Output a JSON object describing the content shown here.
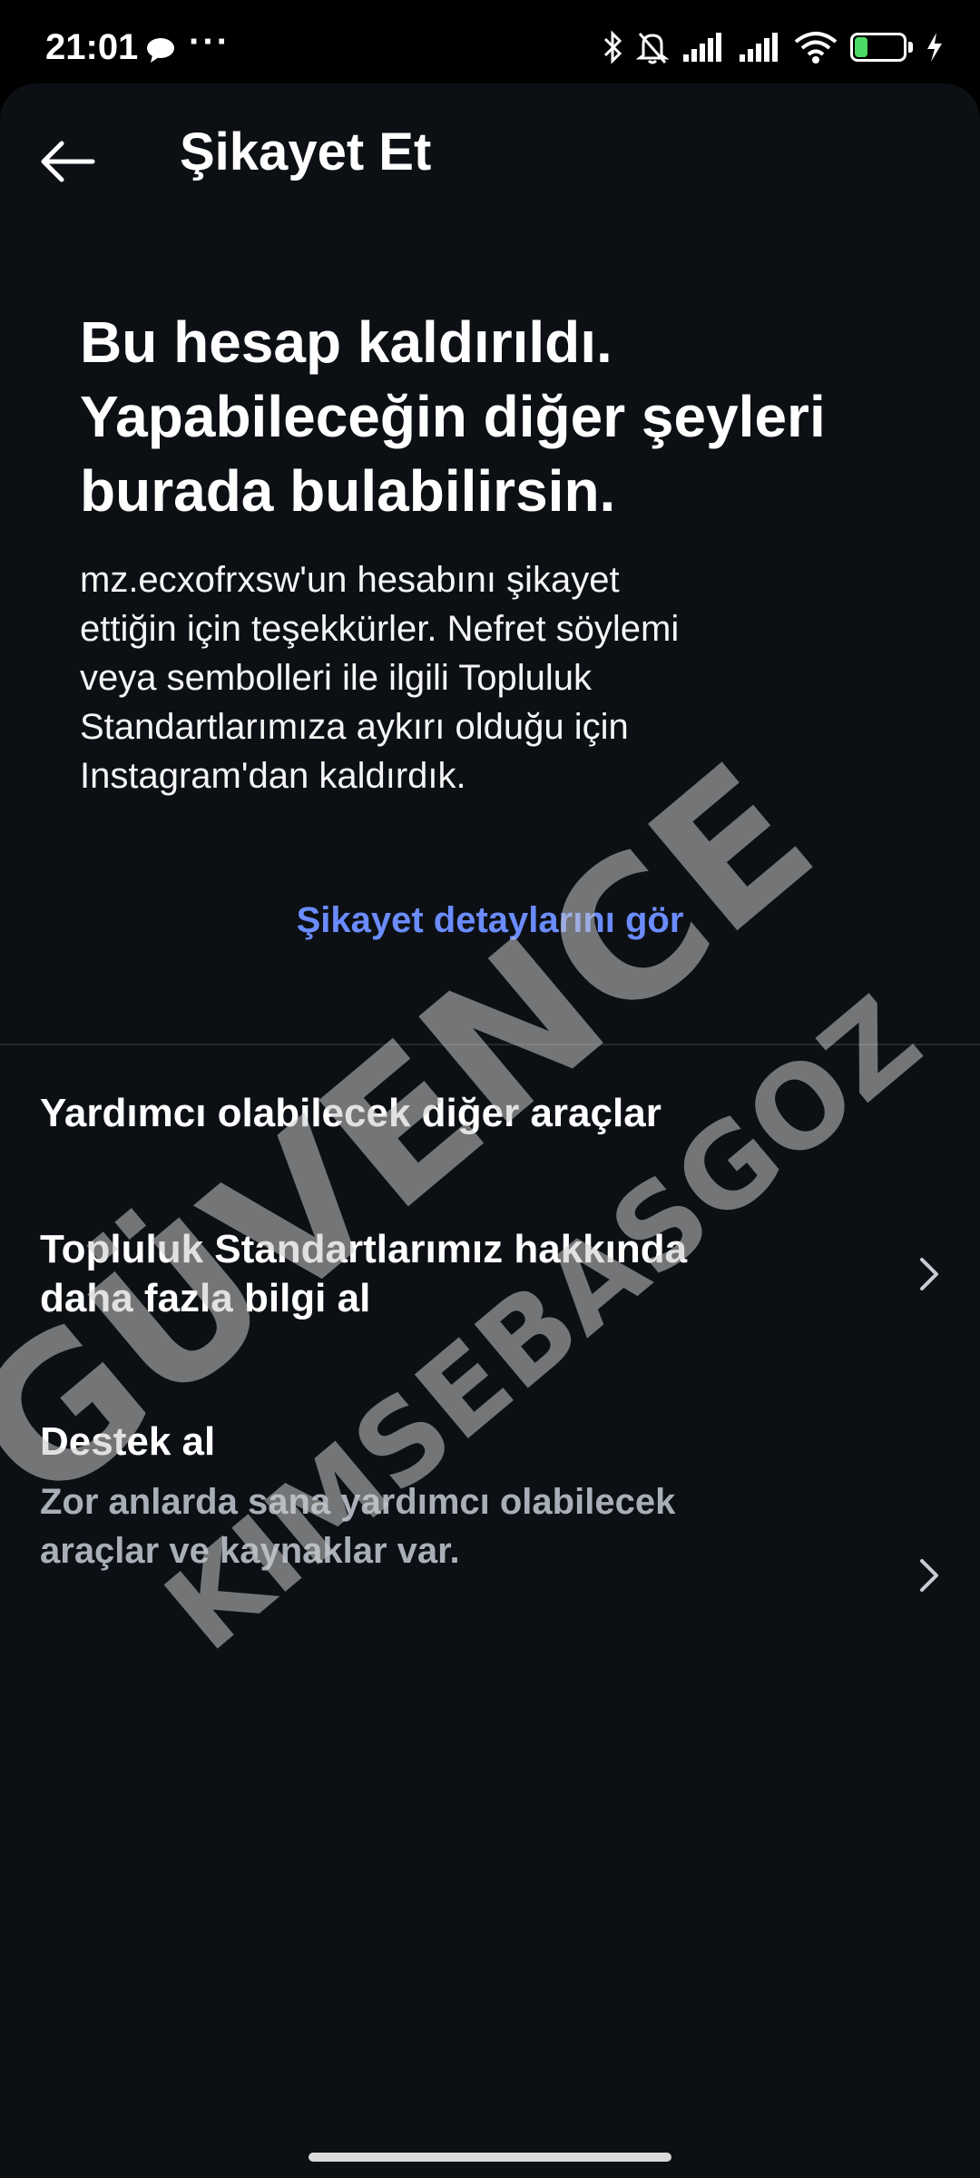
{
  "status_bar": {
    "time": "21:01",
    "dots": "···",
    "battery_level": "26",
    "battery_percent": 26,
    "icons": [
      "chat-bubble-icon",
      "bluetooth-icon",
      "mute-bell-icon",
      "signal-icon",
      "signal-icon",
      "wifi-icon",
      "battery-icon",
      "charging-bolt-icon"
    ]
  },
  "header": {
    "title": "Şikayet Et"
  },
  "headline": {
    "lines": [
      "Bu hesap kaldırıldı.",
      "Yapabileceğin diğer şeyleri",
      "burada bulabilirsin."
    ]
  },
  "body": {
    "lines": [
      "mz.ecxofrxsw'un hesabını şikayet",
      "ettiğin için teşekkürler. Nefret söylemi",
      "veya sembolleri ile ilgili Topluluk",
      "Standartlarımıza aykırı olduğu için",
      "Instagram'dan kaldırdık."
    ]
  },
  "details_link": "Şikayet detaylarını gör",
  "tools": {
    "header": "Yardımcı olabilecek diğer araçlar",
    "items": [
      {
        "title_lines": [
          "Topluluk Standartlarımız hakkında",
          "daha fazla bilgi al"
        ]
      },
      {
        "title_lines": [
          "Destek al"
        ],
        "subtitle_lines": [
          "Zor anlarda sana yardımcı olabilecek",
          "araçlar ve kaynaklar var."
        ]
      }
    ]
  },
  "watermark": {
    "line1": "GÜVENCE",
    "line2": "KIMSEBASGOZ"
  },
  "colors": {
    "background": "#0c1014",
    "link": "#6b8cff",
    "battery": "#4cd964",
    "subtitle": "#a8afb8"
  }
}
